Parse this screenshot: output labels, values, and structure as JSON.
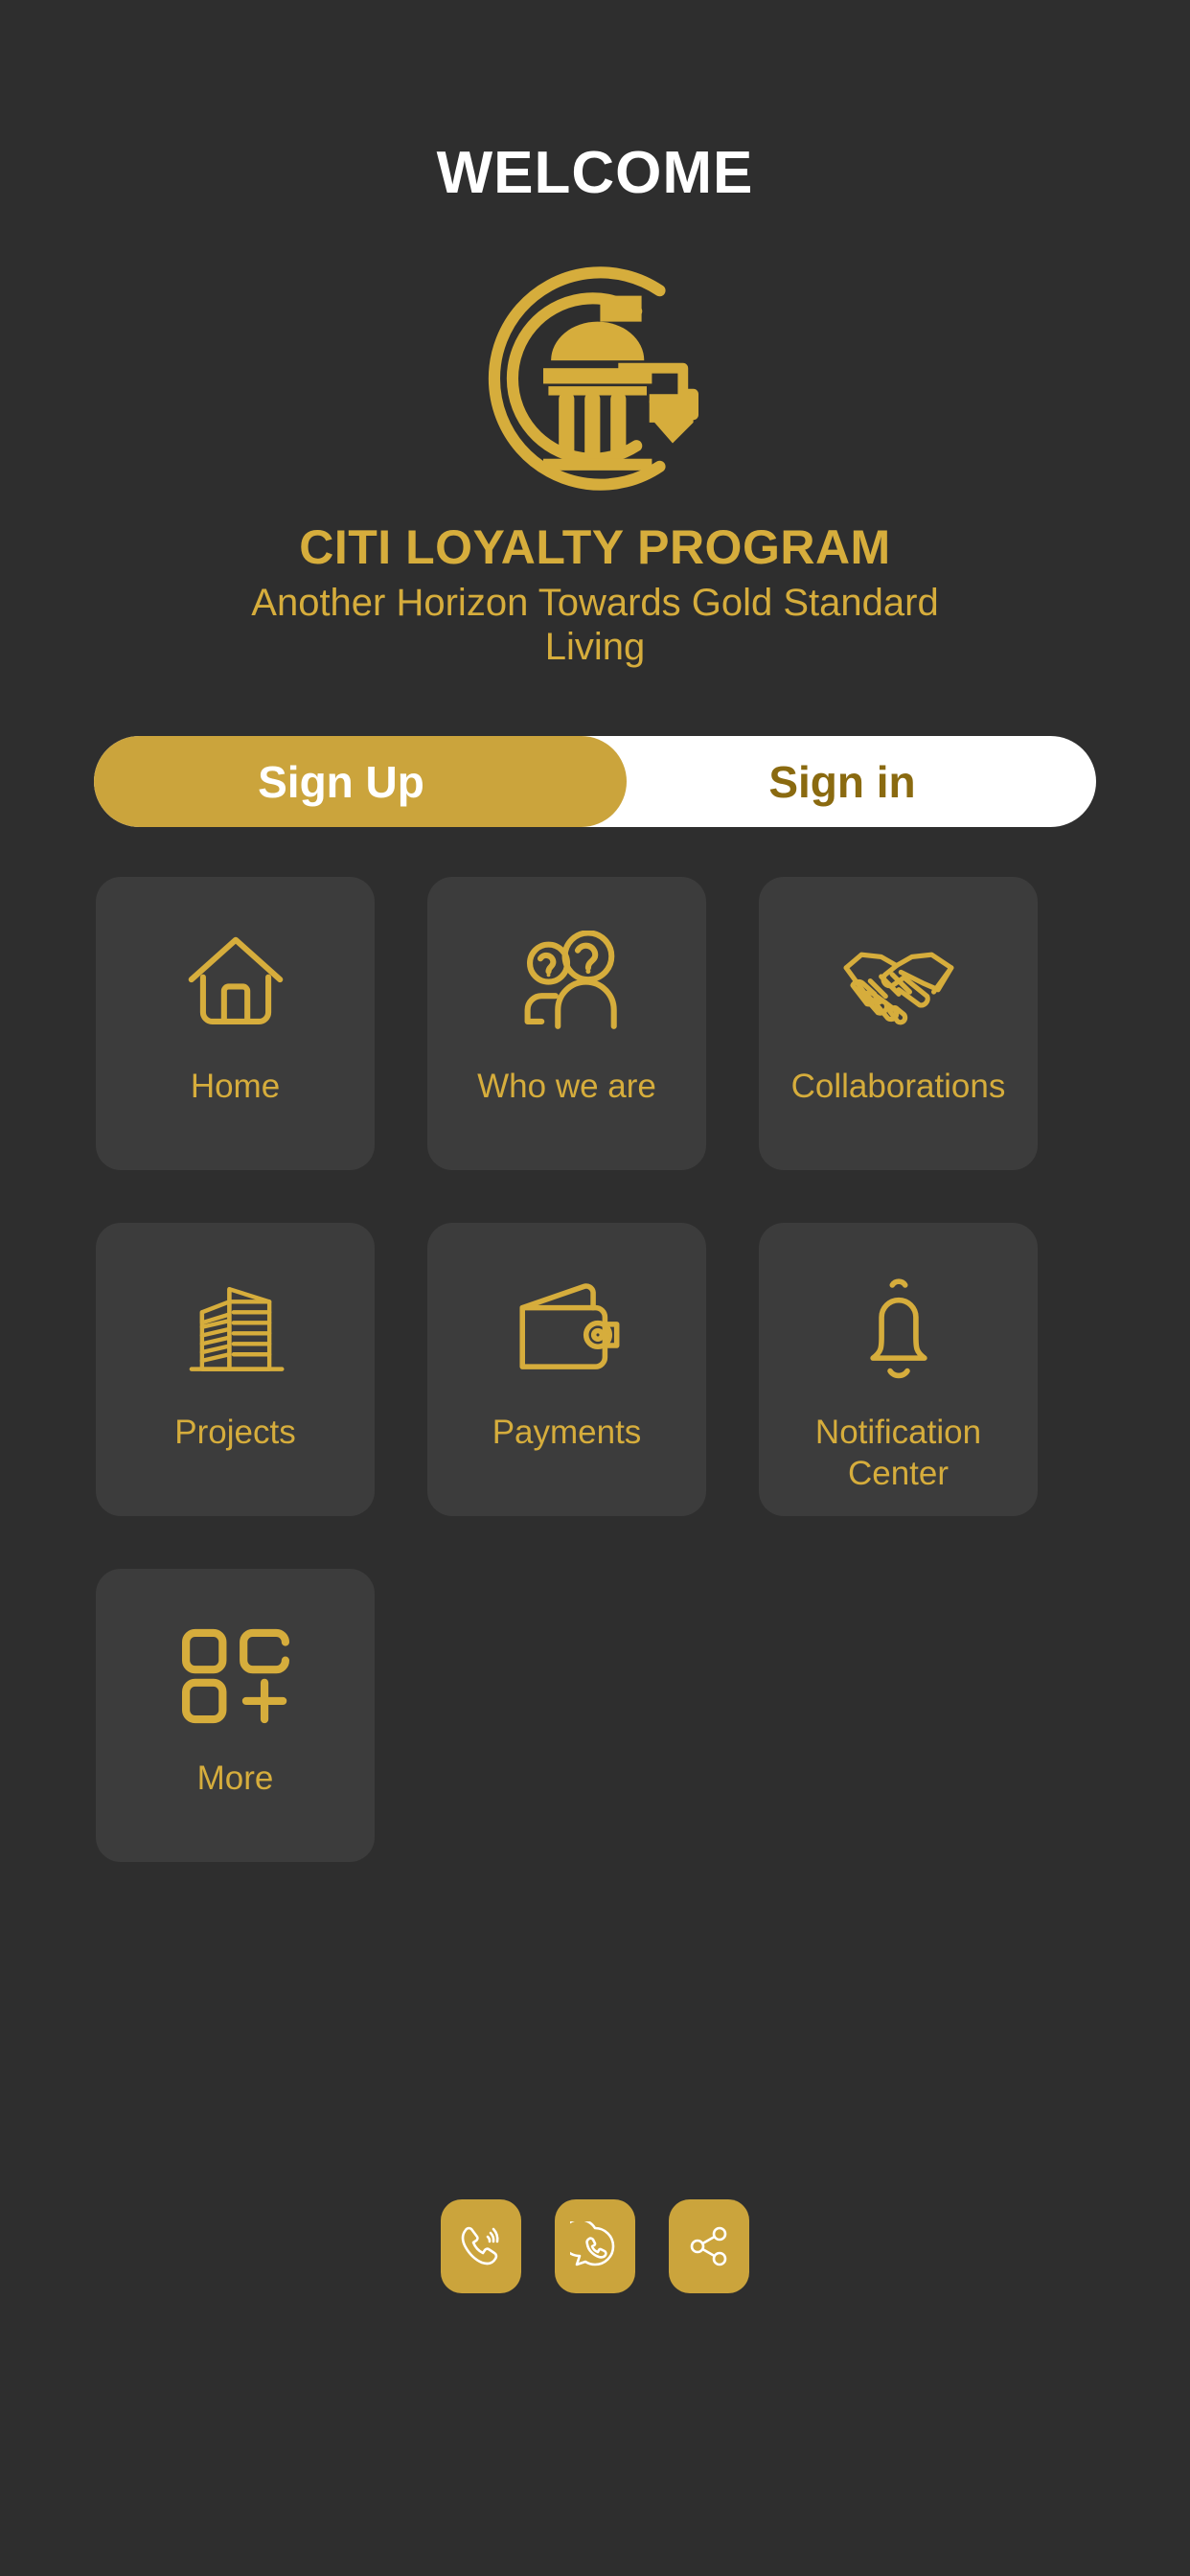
{
  "header": {
    "welcome_title": "WELCOME"
  },
  "brand": {
    "logo_icon": "citi-loyalty-emblem-icon",
    "name": "CITI LOYALTY PROGRAM",
    "tagline": "Another Horizon Towards Gold Standard Living"
  },
  "auth_toggle": {
    "sign_up_label": "Sign Up",
    "sign_in_label": "Sign in",
    "active": "Sign Up"
  },
  "menu": {
    "items": [
      {
        "label": "Home",
        "icon": "home-icon"
      },
      {
        "label": "Who we are",
        "icon": "about-people-question-icon"
      },
      {
        "label": "Collaborations",
        "icon": "handshake-icon"
      },
      {
        "label": "Projects",
        "icon": "building-icon"
      },
      {
        "label": "Payments",
        "icon": "wallet-icon"
      },
      {
        "label": "Notification Center",
        "icon": "bell-icon"
      },
      {
        "label": "More",
        "icon": "grid-more-icon"
      }
    ]
  },
  "bottom_actions": {
    "items": [
      {
        "name": "Call",
        "icon": "phone-call-icon"
      },
      {
        "name": "WhatsApp",
        "icon": "whatsapp-icon"
      },
      {
        "name": "Share",
        "icon": "share-icon"
      }
    ]
  },
  "colors": {
    "background": "#2e2e2e",
    "tile_background": "#3c3c3c",
    "gold": "#d6ad3c",
    "gold_button": "#cba43c",
    "gold_dark": "#8a6a10",
    "white": "#ffffff"
  }
}
